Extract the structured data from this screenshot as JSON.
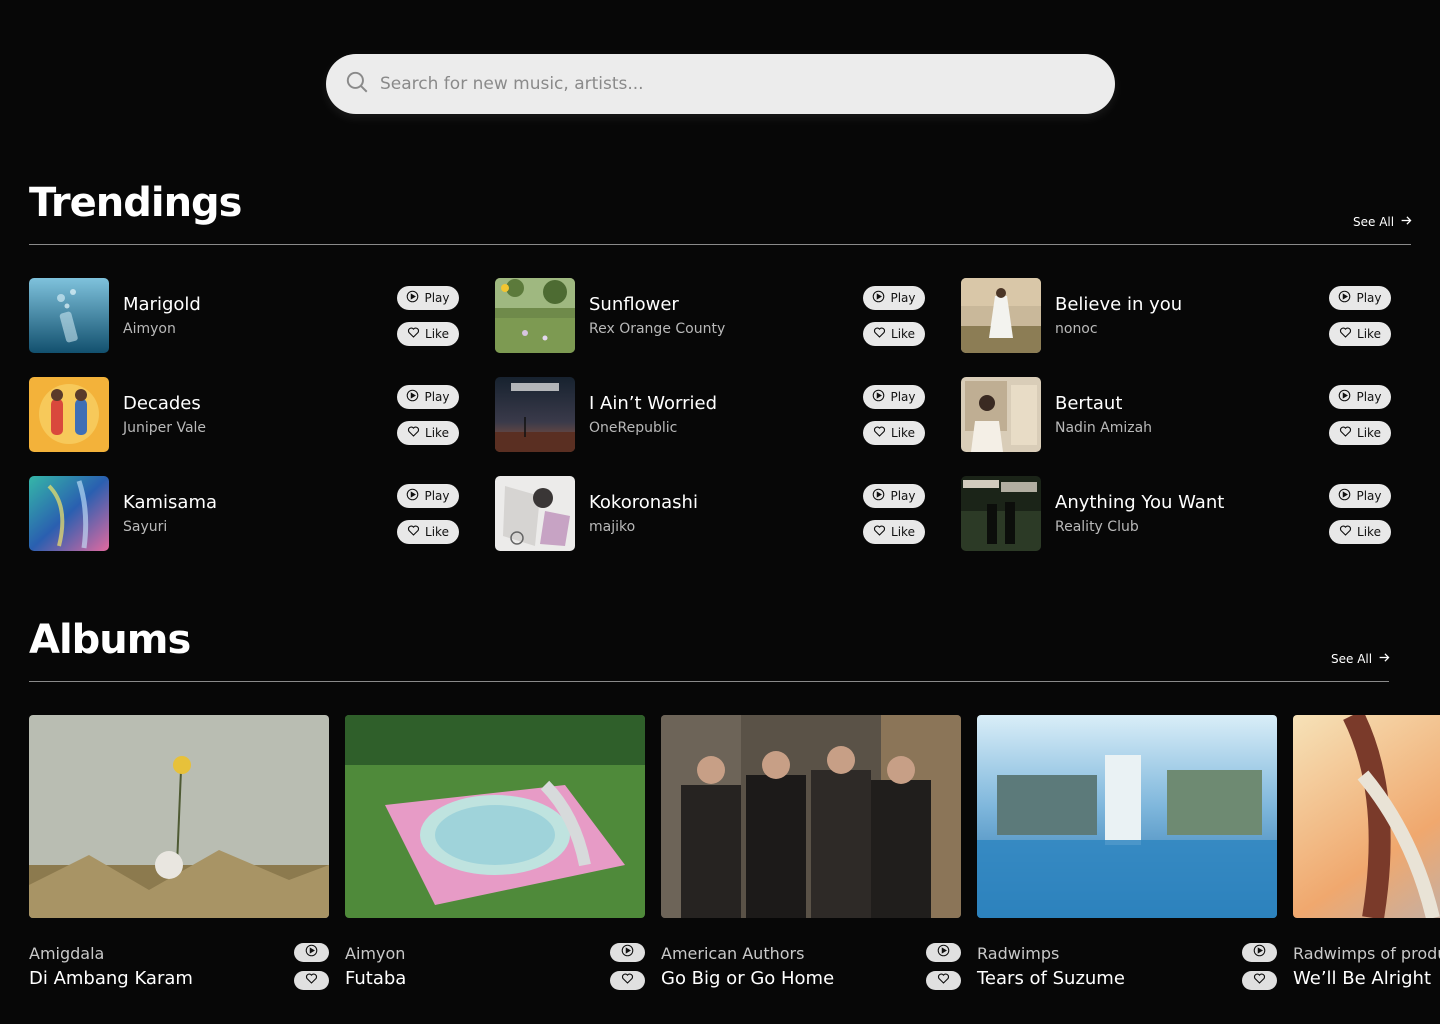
{
  "search": {
    "placeholder": "Search for new music, artists..."
  },
  "trendings": {
    "title": "Trendings",
    "see_all": "See All",
    "play_label": "Play",
    "like_label": "Like",
    "tracks": [
      {
        "title": "Marigold",
        "artist": "Aimyon"
      },
      {
        "title": "Sunflower",
        "artist": "Rex Orange County"
      },
      {
        "title": "Believe in you",
        "artist": "nonoc"
      },
      {
        "title": "Decades",
        "artist": "Juniper Vale"
      },
      {
        "title": "I Ain’t Worried",
        "artist": "OneRepublic"
      },
      {
        "title": "Bertaut",
        "artist": "Nadin Amizah"
      },
      {
        "title": "Kamisama",
        "artist": "Sayuri"
      },
      {
        "title": "Kokoronashi",
        "artist": "majiko"
      },
      {
        "title": "Anything You Want",
        "artist": "Reality Club"
      }
    ]
  },
  "albums": {
    "title": "Albums",
    "see_all": "See All",
    "items": [
      {
        "artist": "Amigdala",
        "name": "Di Ambang Karam"
      },
      {
        "artist": "Aimyon",
        "name": "Futaba"
      },
      {
        "artist": "American Authors",
        "name": "Go Big or Go Home"
      },
      {
        "artist": "Radwimps",
        "name": "Tears of Suzume"
      },
      {
        "artist": "Radwimps of produ",
        "name": "We’ll Be Alright"
      }
    ]
  },
  "colors": {
    "background": "#070707",
    "pill": "#e8e8e8",
    "search_bg": "#ececec",
    "rule": "#8a8a8a"
  }
}
